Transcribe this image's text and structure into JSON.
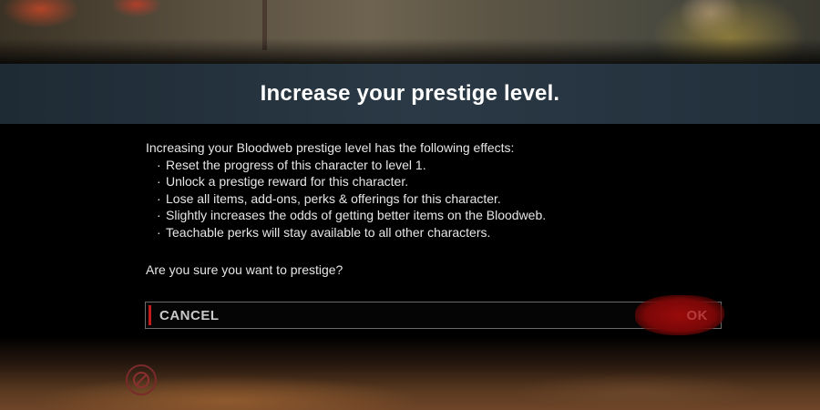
{
  "dialog": {
    "title": "Increase your prestige level.",
    "intro": "Increasing your Bloodweb prestige level has the following effects:",
    "effects": [
      "Reset the progress of this character to level 1.",
      "Unlock a prestige reward for this character.",
      "Lose all items, add-ons, perks & offerings for this character.",
      "Slightly increases the odds of getting better items on the Bloodweb.",
      "Teachable perks will stay available to all other characters."
    ],
    "bullet": "·",
    "question": "Are you sure you want to prestige?"
  },
  "buttons": {
    "cancel_label": "CANCEL",
    "ok_label": "OK"
  },
  "icons": {
    "emblem": "no-item-icon"
  },
  "colors": {
    "accent_red": "#c31a1a",
    "banner": "#2a3945",
    "ok_splash": "#9a0b0b"
  }
}
